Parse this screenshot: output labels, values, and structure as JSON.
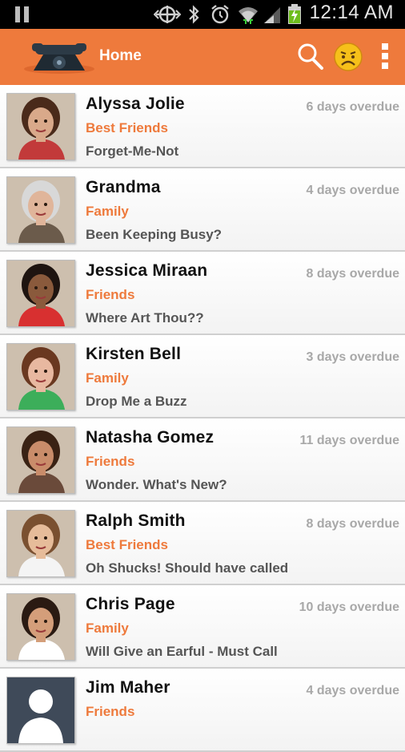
{
  "status_bar": {
    "time": "12:14 AM",
    "icons": [
      "pause-icon",
      "gamepad-icon",
      "bluetooth-icon",
      "alarm-icon",
      "wifi-icon",
      "signal-icon",
      "battery-charging-icon"
    ]
  },
  "action_bar": {
    "title": "Home",
    "logo_icon": "phone-logo-icon",
    "actions": [
      "search-icon",
      "sad-face-icon",
      "overflow-menu-icon"
    ],
    "accent_color": "#ee7a3c"
  },
  "contacts": [
    {
      "name": "Alyssa Jolie",
      "group": "Best Friends",
      "message": "Forget-Me-Not",
      "overdue": "6 days overdue",
      "skin": "#d9a98a",
      "hair": "#4a2a1a",
      "shirt": "#c23a3a"
    },
    {
      "name": "Grandma",
      "group": "Family",
      "message": "Been Keeping Busy?",
      "overdue": "4 days overdue",
      "skin": "#e0b59a",
      "hair": "#d8d8d8",
      "shirt": "#6b5b4b"
    },
    {
      "name": "Jessica Miraan",
      "group": "Friends",
      "message": "Where Art Thou??",
      "overdue": "8 days overdue",
      "skin": "#8a5a3c",
      "hair": "#1e1410",
      "shirt": "#d83030"
    },
    {
      "name": " Kirsten Bell",
      "group": "Family",
      "message": "Drop Me a Buzz",
      "overdue": "3 days overdue",
      "skin": "#e8b8a0",
      "hair": "#6a3820",
      "shirt": "#3cae5a"
    },
    {
      "name": "Natasha Gomez",
      "group": "Friends",
      "message": "Wonder. What's New?",
      "overdue": "11 days overdue",
      "skin": "#c98c6a",
      "hair": "#3a2214",
      "shirt": "#6a4a3a"
    },
    {
      "name": "Ralph Smith",
      "group": "Best Friends",
      "message": "Oh Shucks! Should have called",
      "overdue": "8 days overdue",
      "skin": "#e6bc9a",
      "hair": "#7a5030",
      "shirt": "#f4f4f4"
    },
    {
      "name": "Chris Page",
      "group": "Family",
      "message": "Will Give an Earful - Must Call",
      "overdue": "10 days overdue",
      "skin": "#d49e7a",
      "hair": "#2a1a12",
      "shirt": "#ffffff"
    },
    {
      "name": "Jim Maher",
      "group": "Friends",
      "message": "",
      "overdue": "4 days overdue",
      "skin": "#ffffff",
      "hair": "#3f4a59",
      "shirt": "#3f4a59",
      "placeholder": true
    }
  ]
}
